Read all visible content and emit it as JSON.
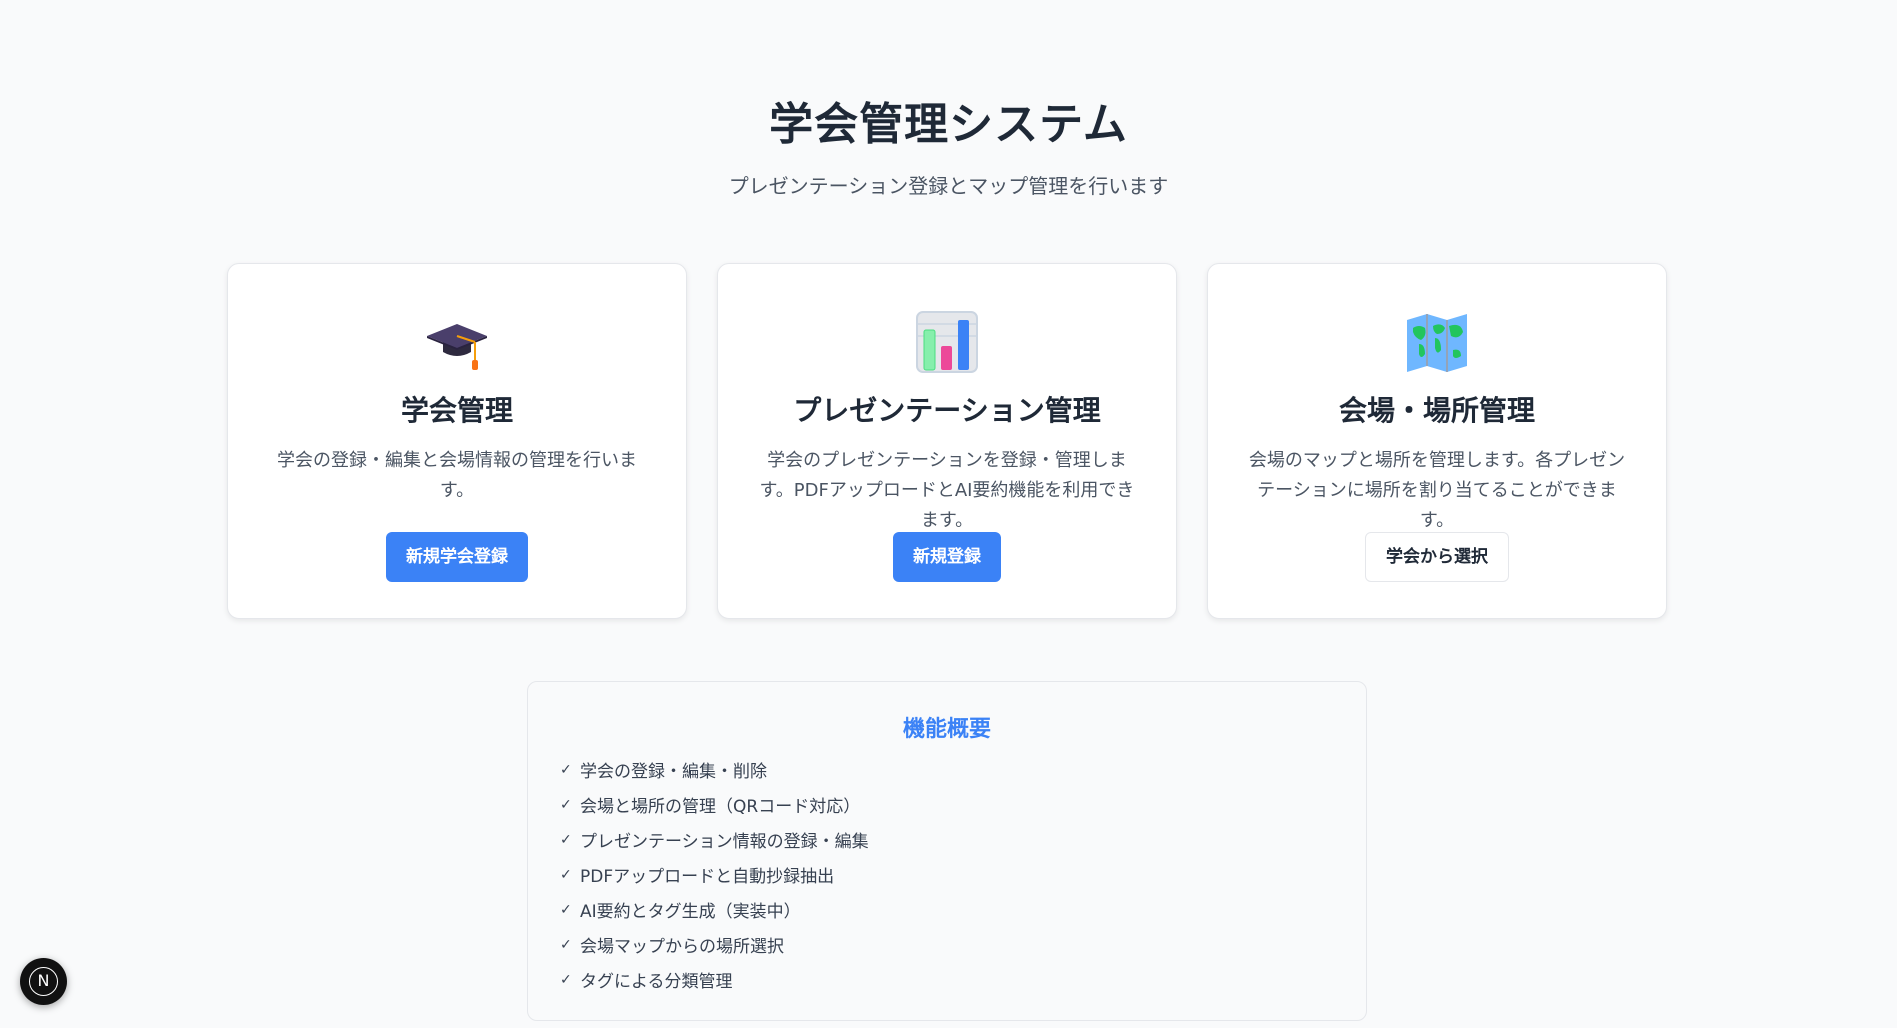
{
  "header": {
    "title": "学会管理システム",
    "subtitle": "プレゼンテーション登録とマップ管理を行います"
  },
  "cards": [
    {
      "icon": "graduation-cap-icon",
      "title": "学会管理",
      "description": "学会の登録・編集と会場情報の管理を行います。",
      "button_label": "新規学会登録",
      "button_style": "primary"
    },
    {
      "icon": "bar-chart-icon",
      "title": "プレゼンテーション管理",
      "description": "学会のプレゼンテーションを登録・管理します。PDFアップロードとAI要約機能を利用できます。",
      "button_label": "新規登録",
      "button_style": "primary"
    },
    {
      "icon": "world-map-icon",
      "title": "会場・場所管理",
      "description": "会場のマップと場所を管理します。各プレゼンテーションに場所を割り当てることができます。",
      "button_label": "学会から選択",
      "button_style": "outline"
    }
  ],
  "overview": {
    "title": "機能概要",
    "check_symbol": "✓",
    "items": [
      "学会の登録・編集・削除",
      "会場と場所の管理（QRコード対応）",
      "プレゼンテーション情報の登録・編集",
      "PDFアップロードと自動抄録抽出",
      "AI要約とタグ生成（実装中）",
      "会場マップからの場所選択",
      "タグによる分類管理"
    ]
  },
  "dev_badge": {
    "letter": "N"
  },
  "colors": {
    "accent": "#3b82f6",
    "background": "#f9fafb",
    "card": "#ffffff"
  }
}
